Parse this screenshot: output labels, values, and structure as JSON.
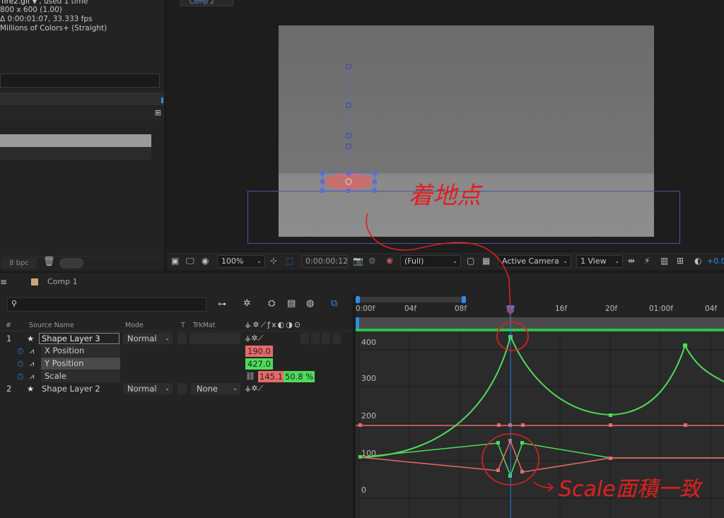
{
  "project": {
    "file_name": "fire2.gif",
    "usage": ", used 1 time",
    "dimensions": "800 x 600 (1.00)",
    "duration": "Δ 0:00:01:07, 33.333 fps",
    "colors": "Millions of Colors+ (Straight)",
    "bpc": "8 bpc"
  },
  "viewer": {
    "tab": "Comp 2",
    "zoom": "100%",
    "timecode": "0:00:00:12",
    "resolution": "(Full)",
    "camera": "Active Camera",
    "views": "1 View",
    "exposure": "+0.0"
  },
  "timeline": {
    "comp_tab": "Comp 1",
    "columns": {
      "num": "#",
      "source": "Source Name",
      "mode": "Mode",
      "t": "T",
      "trkmat": "TrkMat"
    },
    "layers": [
      {
        "num": "1",
        "name": "Shape Layer 3",
        "mode": "Normal"
      },
      {
        "num": "2",
        "name": "Shape Layer 2",
        "mode": "Normal",
        "trkmat": "None"
      }
    ],
    "properties": [
      {
        "name": "X Position",
        "value": "190.0",
        "color": "#e86a6a"
      },
      {
        "name": "Y Position",
        "value": "427.0",
        "color": "#4ddc5a"
      },
      {
        "name": "Scale",
        "value": "145.1",
        "value2": "50.8 %"
      }
    ],
    "ruler": [
      "0:00f",
      "04f",
      "08f",
      "16f",
      "20f",
      "01:00f",
      "04f"
    ],
    "graph_y": [
      "400",
      "300",
      "200",
      "100",
      "0"
    ]
  },
  "annotations": {
    "handwritten_1": "着地点",
    "handwritten_2": "Scale面積一致",
    "color": "#e02020"
  },
  "colors": {
    "accent": "#2d8ceb",
    "x_curve": "#e86a6a",
    "y_curve": "#4ddc5a",
    "selection_box": "#5a6cd8"
  }
}
